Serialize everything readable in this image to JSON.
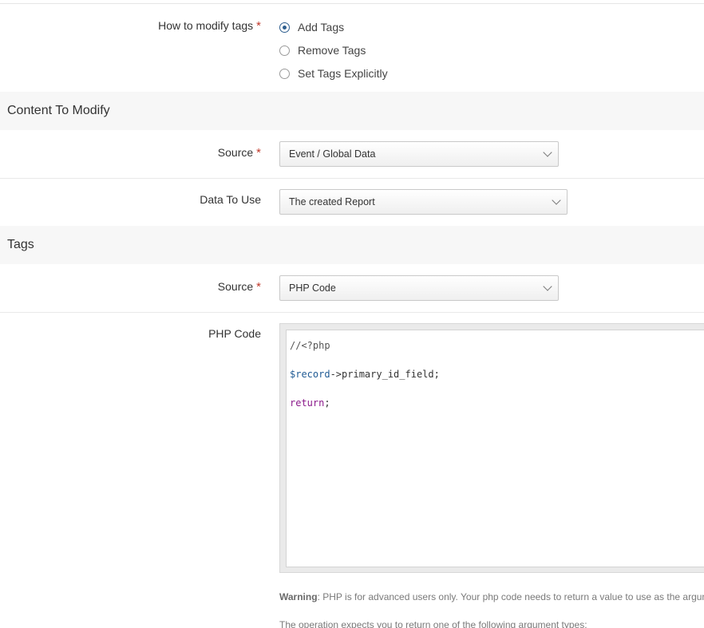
{
  "modify_tags": {
    "label": "How to modify tags",
    "required_marker": "*",
    "options": [
      {
        "label": "Add Tags",
        "checked": true
      },
      {
        "label": "Remove Tags",
        "checked": false
      },
      {
        "label": "Set Tags Explicitly",
        "checked": false
      }
    ]
  },
  "content_section": {
    "title": "Content To Modify",
    "source": {
      "label": "Source",
      "required_marker": "*",
      "value": "Event / Global Data"
    },
    "data_to_use": {
      "label": "Data To Use",
      "value": "The created Report"
    }
  },
  "tags_section": {
    "title": "Tags",
    "source": {
      "label": "Source",
      "required_marker": "*",
      "value": "PHP Code"
    },
    "php_code": {
      "label": "PHP Code",
      "line1": "//<?php",
      "line2_var": "$record",
      "line2_rest": "->primary_id_field;",
      "line3_kw": "return",
      "line3_rest": ";"
    }
  },
  "help": {
    "warning_label": "Warning",
    "warning_text": ": PHP is for advanced users only. Your php code needs to return a value to use as the argume",
    "operation_text": "The operation expects you to return one of the following argument types:"
  }
}
